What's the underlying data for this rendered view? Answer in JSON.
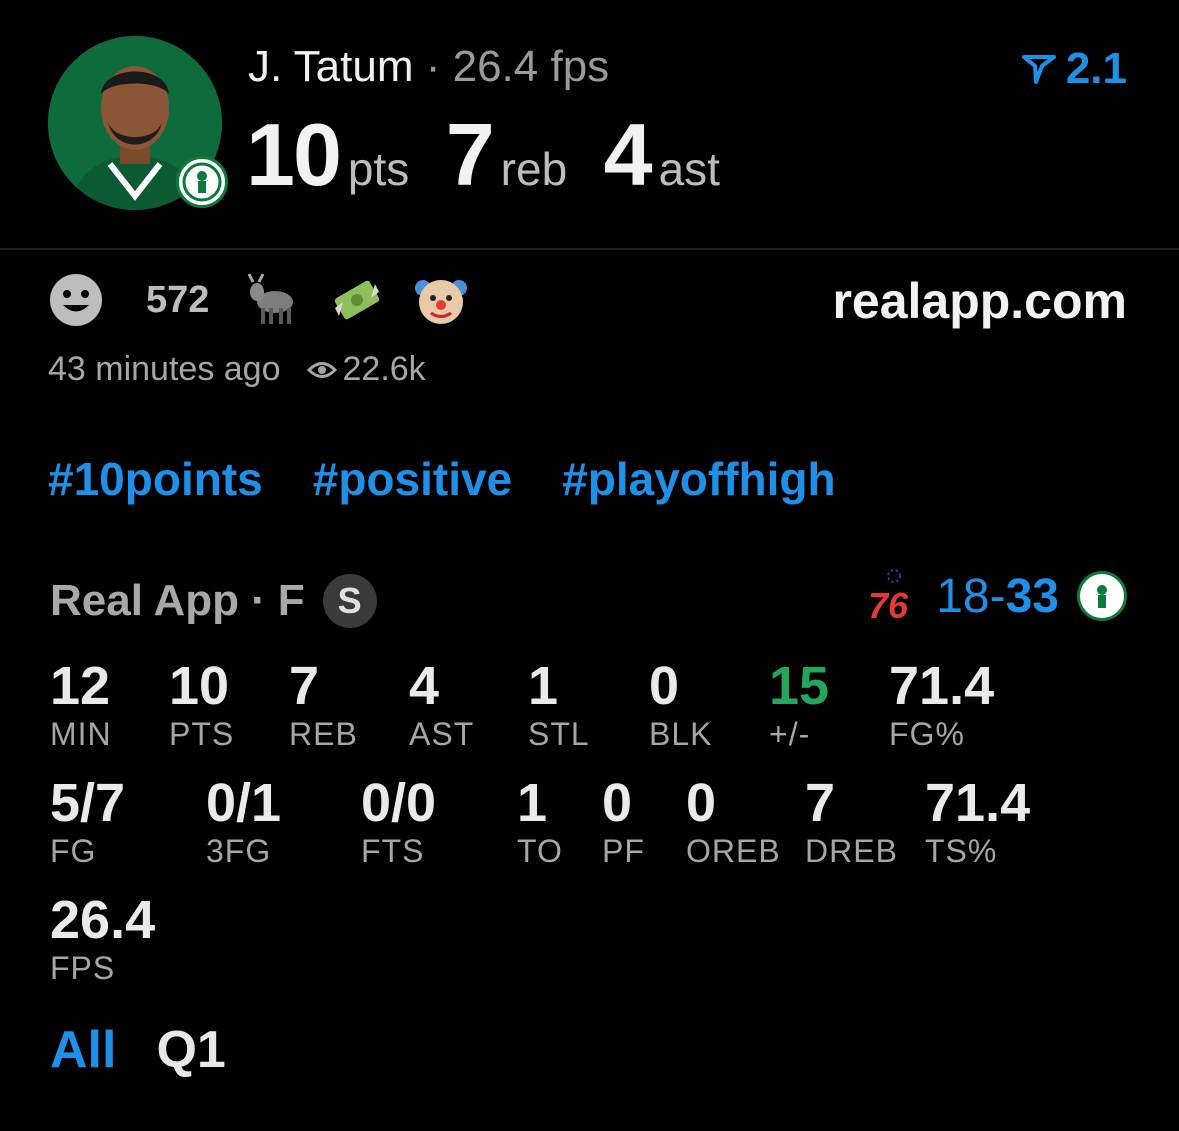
{
  "player": {
    "name": "J. Tatum",
    "separator": "·",
    "fps_label": "26.4 fps",
    "pts_value": "10",
    "pts_unit": "pts",
    "reb_value": "7",
    "reb_unit": "reb",
    "ast_value": "4",
    "ast_unit": "ast"
  },
  "rating": {
    "value": "2.1",
    "icon": "funnel-icon"
  },
  "reactions": {
    "count": "572",
    "icons": [
      "smiley-icon",
      "goat-emoji",
      "money-emoji",
      "clown-emoji"
    ]
  },
  "site": "realapp.com",
  "meta": {
    "time": "43 minutes ago",
    "views": "22.6k",
    "views_icon": "eye-icon"
  },
  "tags": [
    "#10points",
    "#positive",
    "#playoffhigh"
  ],
  "source": {
    "name": "Real App",
    "separator": "·",
    "position": "F",
    "badge": "S"
  },
  "score": {
    "away": "18",
    "dash": "-",
    "home": "33",
    "away_logo": "76",
    "home_team_icon": "celtics-logo"
  },
  "stats": [
    {
      "value": "12",
      "label": "MIN"
    },
    {
      "value": "10",
      "label": "PTS"
    },
    {
      "value": "7",
      "label": "REB"
    },
    {
      "value": "4",
      "label": "AST"
    },
    {
      "value": "1",
      "label": "STL"
    },
    {
      "value": "0",
      "label": "BLK"
    },
    {
      "value": "15",
      "label": "+/-"
    },
    {
      "value": "71.4",
      "label": "FG%"
    },
    {
      "value": "5/7",
      "label": "FG"
    },
    {
      "value": "0/1",
      "label": "3FG"
    },
    {
      "value": "0/0",
      "label": "FTS"
    },
    {
      "value": "1",
      "label": "TO"
    },
    {
      "value": "0",
      "label": "PF"
    },
    {
      "value": "0",
      "label": "OREB"
    },
    {
      "value": "7",
      "label": "DREB"
    },
    {
      "value": "71.4",
      "label": "TS%"
    },
    {
      "value": "26.4",
      "label": "FPS"
    }
  ],
  "filters": [
    {
      "label": "All",
      "active": true
    },
    {
      "label": "Q1",
      "active": false
    }
  ],
  "colors": {
    "accent": "#1e90e8",
    "positive": "#21a85a",
    "celtics_green": "#0e6b3c"
  }
}
